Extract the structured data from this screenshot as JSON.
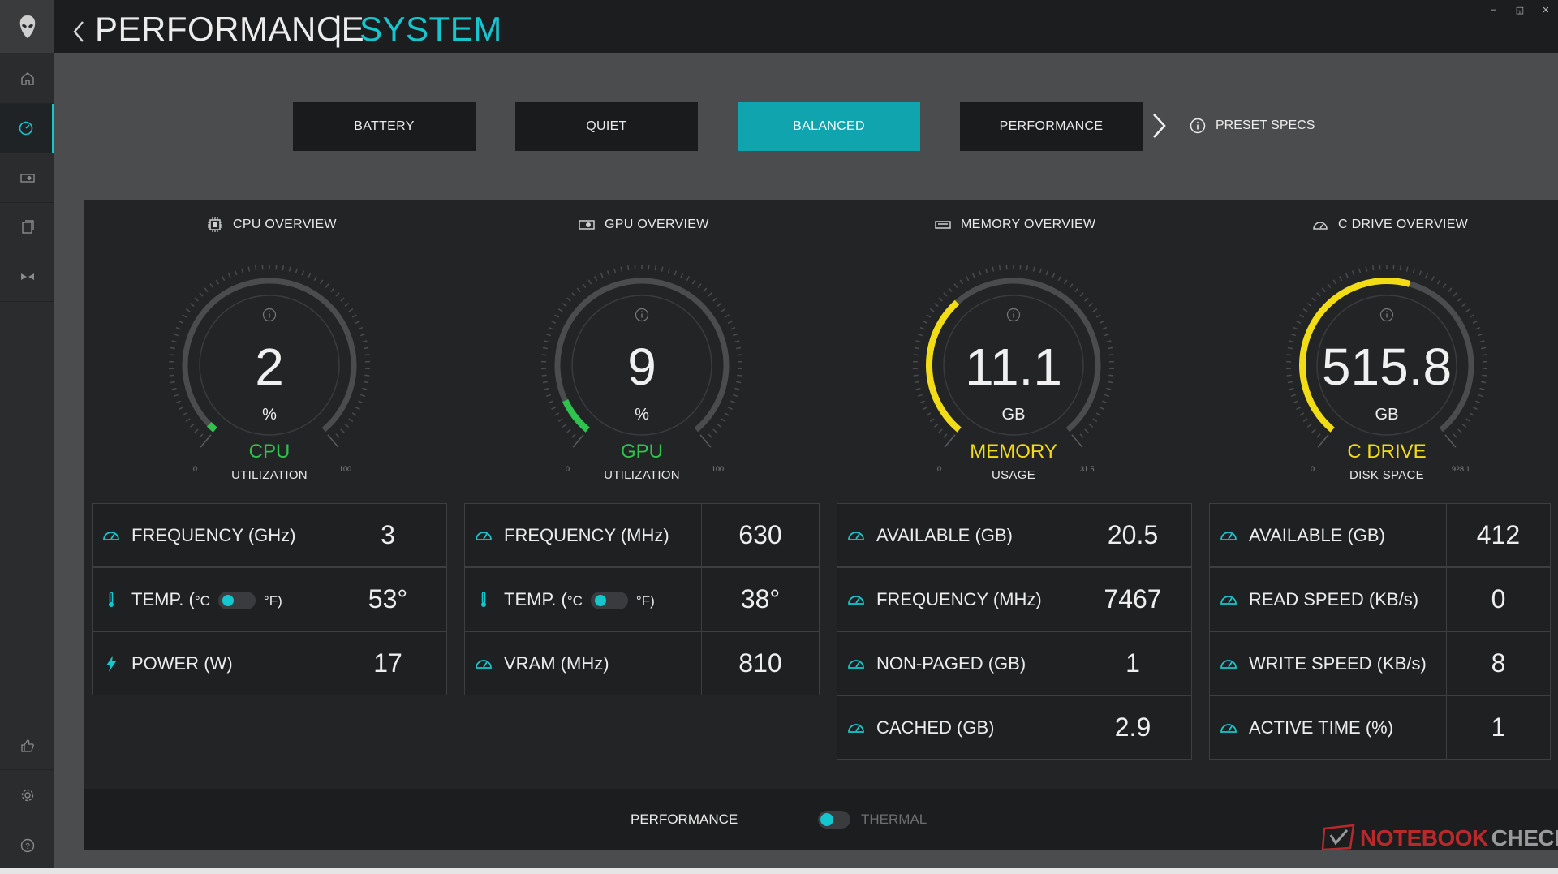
{
  "title": {
    "main": "PERFORMANCE",
    "separator": "|",
    "sub": "SYSTEM"
  },
  "window": {
    "minimize": "–",
    "restore": "◱",
    "close": "✕"
  },
  "presets": {
    "battery": "BATTERY",
    "quiet": "QUIET",
    "balanced": "BALANCED",
    "performance": "PERFORMANCE",
    "specs": "PRESET SPECS"
  },
  "accent": "#16c6cf",
  "cpu": {
    "header": "CPU OVERVIEW",
    "gauge": {
      "value": "2",
      "unit": "%",
      "label": "CPU",
      "sub": "UTILIZATION",
      "min": "0",
      "max": "100",
      "fraction": 0.02,
      "color": "#2fc24f"
    },
    "rows": [
      {
        "label": "FREQUENCY (GHz)",
        "value": "3"
      },
      {
        "label_pre": "TEMP. (",
        "c": "°C",
        "f": "°F)",
        "value": "53°"
      },
      {
        "label": "POWER (W)",
        "value": "17"
      }
    ]
  },
  "gpu": {
    "header": "GPU OVERVIEW",
    "gauge": {
      "value": "9",
      "unit": "%",
      "label": "GPU",
      "sub": "UTILIZATION",
      "min": "0",
      "max": "100",
      "fraction": 0.09,
      "color": "#2fc24f"
    },
    "rows": [
      {
        "label": "FREQUENCY (MHz)",
        "value": "630"
      },
      {
        "label_pre": "TEMP. (",
        "c": "°C",
        "f": "°F)",
        "value": "38°"
      },
      {
        "label": "VRAM (MHz)",
        "value": "810"
      }
    ]
  },
  "memory": {
    "header": "MEMORY OVERVIEW",
    "gauge": {
      "value": "11.1",
      "unit": "GB",
      "label": "MEMORY",
      "sub": "USAGE",
      "min": "0",
      "max": "31.5",
      "fraction": 0.35,
      "color": "#f2dc16"
    },
    "rows": [
      {
        "label": "AVAILABLE (GB)",
        "value": "20.5"
      },
      {
        "label": "FREQUENCY (MHz)",
        "value": "7467"
      },
      {
        "label": "NON-PAGED (GB)",
        "value": "1"
      },
      {
        "label": "CACHED (GB)",
        "value": "2.9"
      }
    ]
  },
  "drive": {
    "header": "C DRIVE OVERVIEW",
    "gauge": {
      "value": "515.8",
      "unit": "GB",
      "label": "C DRIVE",
      "sub": "DISK SPACE",
      "min": "0",
      "max": "928.1",
      "fraction": 0.556,
      "color": "#f2dc16"
    },
    "rows": [
      {
        "label": "AVAILABLE (GB)",
        "value": "412"
      },
      {
        "label": "READ SPEED (KB/s)",
        "value": "0"
      },
      {
        "label": "WRITE SPEED (KB/s)",
        "value": "8"
      },
      {
        "label": "ACTIVE TIME (%)",
        "value": "1"
      }
    ]
  },
  "bottom": {
    "performance": "PERFORMANCE",
    "thermal": "THERMAL"
  },
  "watermark": {
    "a": "NOTEBOOK",
    "b": "CHECK"
  }
}
